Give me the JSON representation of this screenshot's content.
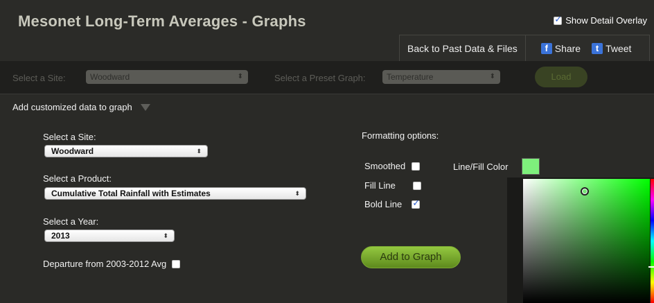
{
  "header": {
    "title": "Mesonet Long-Term Averages - Graphs",
    "overlay_label": "Show Detail Overlay",
    "overlay_checked": true
  },
  "nav": {
    "back_label": "Back to Past Data & Files",
    "share_label": "Share",
    "tweet_label": "Tweet",
    "facebook_glyph": "f",
    "twitter_glyph": "t"
  },
  "toolbar": {
    "site_label": "Select a Site:",
    "site_value": "Woodward",
    "preset_label": "Select a Preset Graph:",
    "preset_value": "Temperature",
    "load_label": "Load"
  },
  "custom": {
    "header_label": "Add customized data to graph",
    "site_label": "Select a Site:",
    "site_value": "Woodward",
    "product_label": "Select a Product:",
    "product_value": "Cumulative Total Rainfall with Estimates",
    "year_label": "Select a Year:",
    "year_value": "2013",
    "departure_label": "Departure from 2003-2012 Avg",
    "departure_checked": false
  },
  "formatting": {
    "title": "Formatting options:",
    "smoothed_label": "Smoothed",
    "smoothed_checked": false,
    "fill_line_label": "Fill Line",
    "fill_line_checked": false,
    "bold_line_label": "Bold Line",
    "bold_line_checked": true,
    "color_label": "Line/Fill Color",
    "color_value": "#7ef07c",
    "add_label": "Add to Graph"
  },
  "colors": {
    "accent_green": "#8cc63f",
    "brand_blue": "#3b73d9"
  }
}
